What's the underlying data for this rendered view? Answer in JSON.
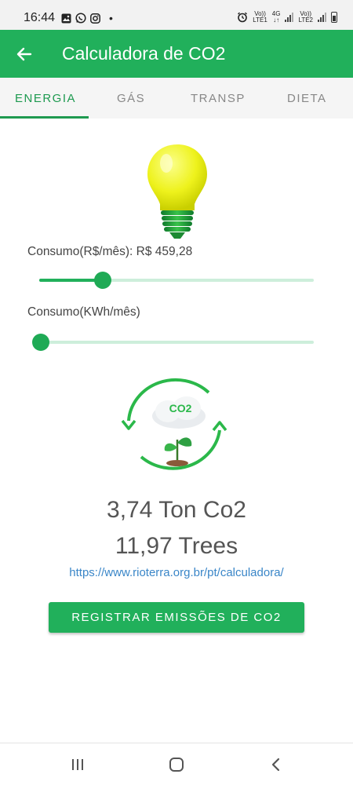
{
  "status_bar": {
    "time": "16:44",
    "left_icons": [
      "gallery-icon",
      "whatsapp-icon",
      "instagram-icon"
    ],
    "dot": "•",
    "sim1_label_top": "Vo))",
    "sim1_label_bottom": "LTE1",
    "network_label_top": "4G",
    "network_label_bottom": "↓↑",
    "sim2_label_top": "Vo))",
    "sim2_label_bottom": "LTE2"
  },
  "app_bar": {
    "title": "Calculadora de CO2",
    "back_icon": "arrow-back-icon"
  },
  "tabs": [
    {
      "label": "ENERGIA",
      "active": true
    },
    {
      "label": "GÁS",
      "active": false
    },
    {
      "label": "TRANSP",
      "active": false
    },
    {
      "label": "DIETA",
      "active": false
    }
  ],
  "energy": {
    "consumo_reais_label": "Consumo(R$/mês): R$ 459,28",
    "consumo_reais_slider_fraction": 0.23,
    "consumo_kwh_label": "Consumo(KWh/mês)",
    "consumo_kwh_slider_fraction": 0.0
  },
  "co2_graphic": {
    "text": "CO2"
  },
  "results": {
    "co2": "3,74 Ton Co2",
    "trees": "11,97 Trees",
    "link": "https://www.rioterra.org.br/pt/calculadora/"
  },
  "actions": {
    "register_label": "REGISTRAR EMISSÕES DE CO2"
  },
  "colors": {
    "primary": "#21b05b",
    "accent": "#1e9a50",
    "link": "#3a86c8"
  },
  "nav_bar": {
    "items": [
      "recent-apps-icon",
      "home-icon",
      "back-icon"
    ]
  }
}
